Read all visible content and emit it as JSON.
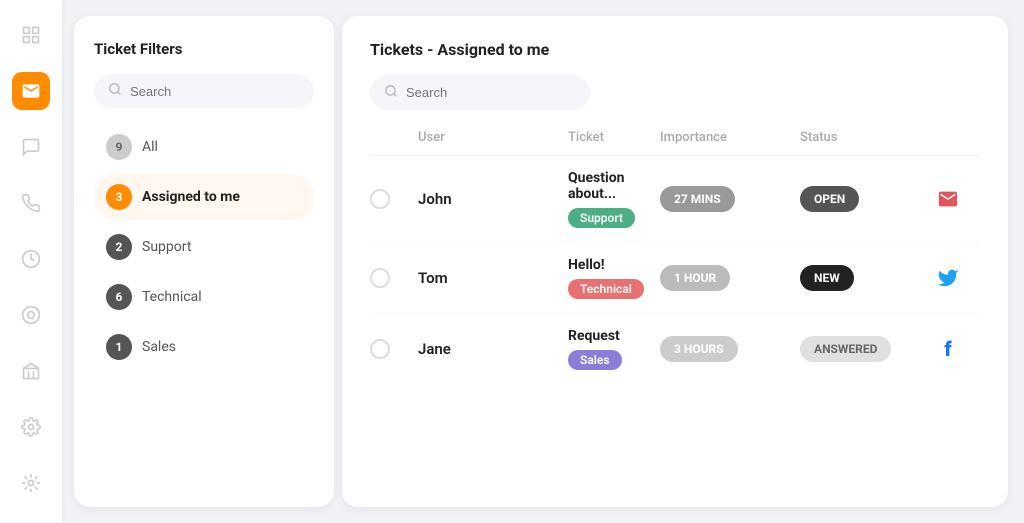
{
  "sidebar": {
    "icons": [
      {
        "name": "grid-icon",
        "symbol": "⊞",
        "active": false
      },
      {
        "name": "mail-icon",
        "symbol": "✉",
        "active": true
      },
      {
        "name": "chat-icon",
        "symbol": "💬",
        "active": false
      },
      {
        "name": "phone-icon",
        "symbol": "📞",
        "active": false
      },
      {
        "name": "clock-icon",
        "symbol": "⏱",
        "active": false
      },
      {
        "name": "shape-icon",
        "symbol": "◎",
        "active": false
      },
      {
        "name": "building-icon",
        "symbol": "🏛",
        "active": false
      },
      {
        "name": "gear-icon",
        "symbol": "⚙",
        "active": false
      },
      {
        "name": "settings2-icon",
        "symbol": "⚙",
        "active": false
      }
    ]
  },
  "filters_panel": {
    "title": "Ticket Filters",
    "search_placeholder": "Search",
    "filters": [
      {
        "label": "All",
        "count": 9,
        "badge_class": "badge-gray",
        "active": false
      },
      {
        "label": "Assigned to me",
        "count": 3,
        "badge_class": "badge-orange",
        "active": true
      },
      {
        "label": "Support",
        "count": 2,
        "badge_class": "badge-dark",
        "active": false
      },
      {
        "label": "Technical",
        "count": 6,
        "badge_class": "badge-dark",
        "active": false
      },
      {
        "label": "Sales",
        "count": 1,
        "badge_class": "badge-dark",
        "active": false
      }
    ]
  },
  "main_panel": {
    "title": "Tickets - Assigned to me",
    "search_placeholder": "Search",
    "table": {
      "headers": [
        "",
        "User",
        "Ticket",
        "Importance",
        "Status",
        ""
      ],
      "rows": [
        {
          "user": "John",
          "ticket_title": "Question about...",
          "ticket_tag": "Support",
          "ticket_tag_class": "tag-green",
          "importance": "27 MINS",
          "importance_class": "imp-gray",
          "status": "OPEN",
          "status_class": "status-open",
          "social": "✉",
          "social_class": "icon-email",
          "social_name": "email-icon"
        },
        {
          "user": "Tom",
          "ticket_title": "Hello!",
          "ticket_tag": "Technical",
          "ticket_tag_class": "tag-red",
          "importance": "1 HOUR",
          "importance_class": "imp-light",
          "status": "NEW",
          "status_class": "status-new",
          "social": "🐦",
          "social_class": "icon-twitter",
          "social_name": "twitter-icon"
        },
        {
          "user": "Jane",
          "ticket_title": "Request",
          "ticket_tag": "Sales",
          "ticket_tag_class": "tag-purple",
          "importance": "3 HOURS",
          "importance_class": "imp-lighter",
          "status": "ANSWERED",
          "status_class": "status-answered",
          "social": "f",
          "social_class": "icon-facebook",
          "social_name": "facebook-icon"
        }
      ]
    }
  }
}
